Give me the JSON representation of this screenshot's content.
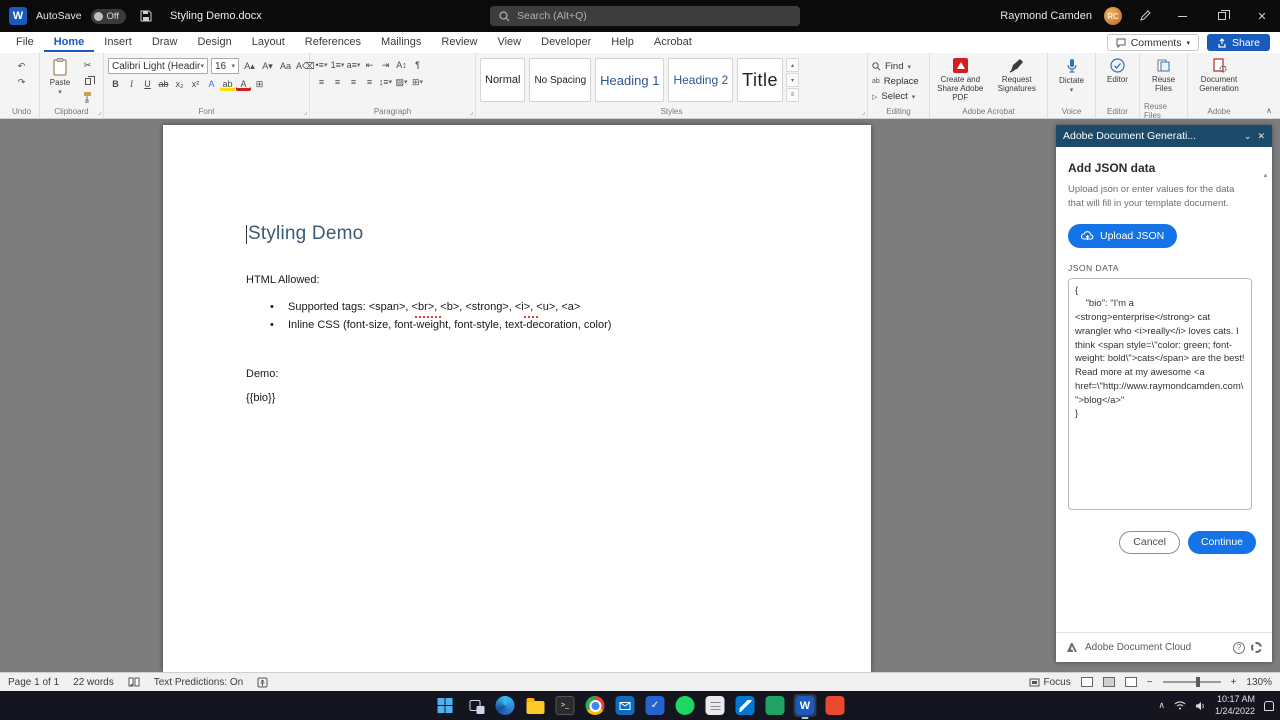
{
  "colors": {
    "adobe_blue": "#1473e6",
    "word_blue": "#185abd",
    "heading_blue": "#2f5496",
    "panel_header": "#1b4a6b"
  },
  "icons": {
    "word_logo": "W",
    "undo": "↶",
    "redo": "↷",
    "scissors": "✂",
    "bold": "B",
    "italic": "I",
    "underline": "U",
    "strike": "ab",
    "subscript": "x₂",
    "superscript": "x²",
    "text_effects": "A",
    "highlight": "ab",
    "font_color": "A",
    "change_case": "Aa",
    "grow_font": "A▴",
    "shrink_font": "A▾",
    "clear_format": "A⌫",
    "replace": "ab",
    "check": "✓",
    "terminal_prompt": ">_",
    "paragraph_mark": "¶"
  },
  "titlebar": {
    "autosave_label": "AutoSave",
    "autosave_state": "Off",
    "doc_title": "Styling Demo.docx",
    "search_placeholder": "Search (Alt+Q)",
    "user_name": "Raymond Camden",
    "user_initials": "RC"
  },
  "ribbon": {
    "tabs": [
      "File",
      "Home",
      "Insert",
      "Draw",
      "Design",
      "Layout",
      "References",
      "Mailings",
      "Review",
      "View",
      "Developer",
      "Help",
      "Acrobat"
    ],
    "active_tab": "Home",
    "comments_label": "Comments",
    "share_label": "Share",
    "paste_label": "Paste",
    "font_name": "Calibri Light (Headir",
    "font_size": "16",
    "styles": [
      "Normal",
      "No Spacing",
      "Heading 1",
      "Heading 2",
      "Title"
    ],
    "find_label": "Find",
    "replace_label": "Replace",
    "select_label": "Select",
    "acrobat_create_label": "Create and Share Adobe PDF",
    "acrobat_request_label": "Request Signatures",
    "dictate_label": "Dictate",
    "editor_button_label": "Editor",
    "reuse_button_label": "Reuse Files",
    "docgen_button_label": "Document Generation",
    "group_labels": {
      "undo": "Undo",
      "clipboard": "Clipboard",
      "font": "Font",
      "paragraph": "Paragraph",
      "styles": "Styles",
      "editing": "Editing",
      "acrobat": "Adobe Acrobat",
      "voice": "Voice",
      "editor": "Editor",
      "reuse": "Reuse Files",
      "adobe": "Adobe"
    }
  },
  "document": {
    "title": "Styling Demo",
    "intro": "HTML Allowed:",
    "bullets": [
      "Supported tags: <span>, <br>, <b>, <strong>, <i>, <u>, <a>",
      "Inline CSS (font-size, font-weight, font-style, text-decoration, color)"
    ],
    "demo_label": "Demo:",
    "template_token": "{{bio}}"
  },
  "panel": {
    "window_title": "Adobe Document Generati...",
    "heading": "Add JSON data",
    "description": "Upload json or enter values for the data that will fill in your template document.",
    "upload_button": "Upload JSON",
    "json_data_label": "JSON DATA",
    "json_text": "{\n    \"bio\": \"I'm a <strong>enterprise</strong> cat wrangler who <i>really</i> loves cats. I think <span style=\\\"color: green; font-weight: bold\\\">cats</span> are the best! Read more at my awesome <a href=\\\"http://www.raymondcamden.com\\\">blog</a>\"\n}",
    "cancel_button": "Cancel",
    "continue_button": "Continue",
    "footer_label": "Adobe Document Cloud"
  },
  "status": {
    "page": "Page 1 of 1",
    "words": "22 words",
    "predictions": "Text Predictions: On",
    "focus": "Focus",
    "zoom": "130%"
  },
  "taskbar": {
    "time": "10:17 AM",
    "date": "1/24/2022"
  }
}
